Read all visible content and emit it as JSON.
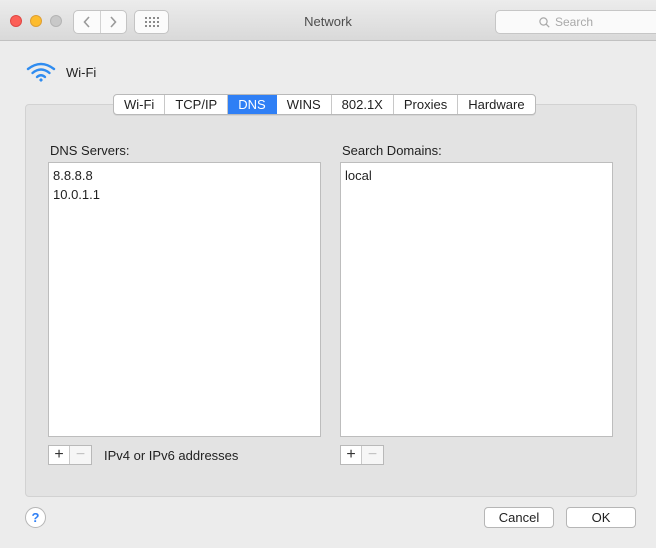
{
  "window": {
    "title": "Network"
  },
  "toolbar": {
    "search_placeholder": "Search"
  },
  "service": {
    "name": "Wi-Fi"
  },
  "tabs": [
    {
      "label": "Wi-Fi",
      "active": false
    },
    {
      "label": "TCP/IP",
      "active": false
    },
    {
      "label": "DNS",
      "active": true
    },
    {
      "label": "WINS",
      "active": false
    },
    {
      "label": "802.1X",
      "active": false
    },
    {
      "label": "Proxies",
      "active": false
    },
    {
      "label": "Hardware",
      "active": false
    }
  ],
  "dns": {
    "label": "DNS Servers:",
    "servers": [
      "8.8.8.8",
      "10.0.1.1"
    ],
    "hint": "IPv4 or IPv6 addresses"
  },
  "search_domains": {
    "label": "Search Domains:",
    "domains": [
      "local"
    ]
  },
  "controls": {
    "plus": "+",
    "minus": "−"
  },
  "footer": {
    "help": "?",
    "cancel_label": "Cancel",
    "ok_label": "OK"
  },
  "colors": {
    "accent": "#2f7ff5",
    "wifi_icon": "#2f8cf0"
  },
  "icons": [
    "chevron-left-icon",
    "chevron-right-icon",
    "grid-icon",
    "search-icon",
    "wifi-icon"
  ]
}
